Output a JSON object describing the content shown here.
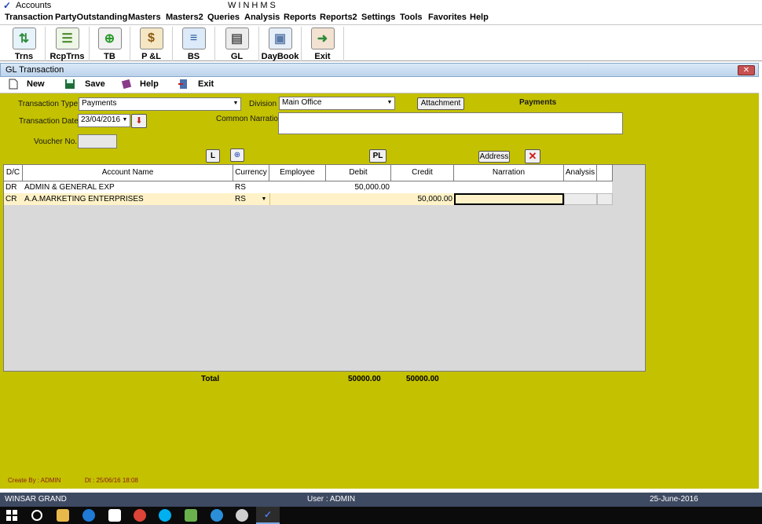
{
  "app": {
    "check": "✓",
    "name": "Accounts",
    "center_title": "WINHMS"
  },
  "menu": [
    "Transaction",
    "PartyOutstanding",
    "Masters",
    "Masters2",
    "Queries",
    "Analysis",
    "Reports",
    "Reports2",
    "Settings",
    "Tools",
    "Favorites",
    "Help"
  ],
  "toolbar": [
    {
      "label": "Trns",
      "icon": "trns-icon",
      "color": "#3ca0d8"
    },
    {
      "label": "RcpTrns",
      "icon": "receipt-list-icon",
      "color": "#7bb661"
    },
    {
      "label": "TB",
      "icon": "trial-balance-icon",
      "color": "#3aa63a"
    },
    {
      "label": "P &L",
      "icon": "money-bag-icon",
      "color": "#c9a24a"
    },
    {
      "label": "BS",
      "icon": "balance-sheet-icon",
      "color": "#5f9bd9"
    },
    {
      "label": "GL",
      "icon": "ledger-icon",
      "color": "#8c8c8c"
    },
    {
      "label": "DayBook",
      "icon": "daybook-icon",
      "color": "#9fb8d8"
    },
    {
      "label": "Exit",
      "icon": "exit-door-icon",
      "color": "#b5652b"
    }
  ],
  "window": {
    "title": "GL Transaction",
    "close": "✕"
  },
  "commands": {
    "new": "New",
    "save": "Save",
    "help": "Help",
    "exit": "Exit"
  },
  "form": {
    "transaction_type_label": "Transaction Type",
    "transaction_type_value": "Payments",
    "division_label": "Division",
    "division_value": "Main Office",
    "attachment": "Attachment",
    "mode_label": "Payments",
    "transaction_date_label": "Transaction Date",
    "transaction_date_value": "23/04/2016",
    "common_narration_label": "Common Narration",
    "voucher_label": "Voucher No.",
    "btn_L": "L",
    "btn_PL": "PL",
    "address": "Address"
  },
  "grid": {
    "headers": [
      "D/C",
      "Account Name",
      "Currency",
      "Employee",
      "Debit",
      "Credit",
      "Narration",
      "Analysis"
    ],
    "rows": [
      {
        "dc": "DR",
        "account": "ADMIN & GENERAL EXP",
        "currency": "RS",
        "employee": "",
        "debit": "50,000.00",
        "credit": "",
        "narration": ""
      },
      {
        "dc": "CR",
        "account": "A.A.MARKETING ENTERPRISES",
        "currency": "RS",
        "employee": "",
        "debit": "",
        "credit": "50,000.00",
        "narration": ""
      }
    ]
  },
  "totals": {
    "label": "Total",
    "debit": "50000.00",
    "credit": "50000.00"
  },
  "footer": {
    "created_by": "Create By : ADMIN",
    "dt": "Dt : 25/06/16   18:08"
  },
  "status": {
    "company": "WINSAR GRAND",
    "user": "User :  ADMIN",
    "date": "25-June-2016"
  },
  "colors": {
    "form_bg": "#c4c100",
    "status_bg": "#3e4a62",
    "cr_row": "#fff2c8"
  }
}
